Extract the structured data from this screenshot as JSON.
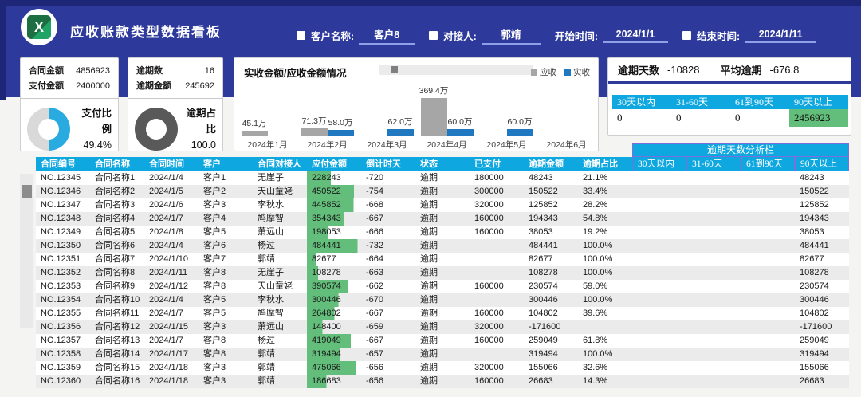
{
  "header": {
    "title": "应收账款类型数据看板",
    "filters": [
      {
        "label": "客户名称:",
        "value": "客户8"
      },
      {
        "label": "对接人:",
        "value": "郭靖"
      },
      {
        "label": "开始时间:",
        "value": "2024/1/1"
      },
      {
        "label": "结束时间:",
        "value": "2024/1/11"
      }
    ]
  },
  "cards": {
    "payment": {
      "label1": "合同金额",
      "value1": "4856923",
      "label2": "支付金额",
      "value2": "2400000",
      "donut_label": "支付比例",
      "donut_value": "49.4%",
      "percent": 49.4
    },
    "overdue": {
      "label1": "逾期数",
      "value1": "16",
      "label2": "逾期金额",
      "value2": "245692",
      "donut_label": "逾期占比",
      "donut_value": "100.0",
      "percent": 100
    }
  },
  "chart_data": {
    "type": "bar",
    "title": "实收金额/应收金额情况",
    "categories": [
      "2024年1月",
      "2024年2月",
      "2024年3月",
      "2024年4月",
      "2024年5月",
      "2024年6月"
    ],
    "series": [
      {
        "name": "应收",
        "color": "#a6a6a6",
        "values": [
          45.1,
          71.3,
          null,
          369.4,
          null,
          null
        ]
      },
      {
        "name": "实收",
        "color": "#1f78c0",
        "values": [
          null,
          58.0,
          62.0,
          60.0,
          60.0,
          null
        ]
      }
    ],
    "unit": "万",
    "ylim": [
      0,
      380
    ],
    "legend_position": "top-right",
    "grid": false
  },
  "overdue_panel": {
    "label1": "逾期天数",
    "value1": "-10828",
    "label2": "平均逾期",
    "value2": "-676.8",
    "bucket_headers": [
      "30天以内",
      "31-60天",
      "61到90天",
      "90天以上"
    ],
    "bucket_values": [
      "0",
      "0",
      "0",
      "2456923"
    ],
    "highlight_index": 3
  },
  "table": {
    "group_header": "逾期天数分析栏",
    "columns": [
      "合同编号",
      "合同名称",
      "合同时间",
      "客户",
      "合同对接人",
      "应付金额",
      "倒计时天",
      "状态",
      "已支付",
      "逾期金额",
      "逾期占比",
      "30天以内",
      "31-60天",
      "61到90天",
      "90天以上"
    ],
    "amount_bar_max": 520000,
    "rows": [
      [
        "NO.12345",
        "合同名称1",
        "2024/1/4",
        "客户1",
        "无崖子",
        "228243",
        "-720",
        "逾期",
        "180000",
        "48243",
        "21.1%",
        "",
        "",
        "",
        "48243"
      ],
      [
        "NO.12346",
        "合同名称2",
        "2024/1/5",
        "客户2",
        "天山童姥",
        "450522",
        "-754",
        "逾期",
        "300000",
        "150522",
        "33.4%",
        "",
        "",
        "",
        "150522"
      ],
      [
        "NO.12347",
        "合同名称3",
        "2024/1/6",
        "客户3",
        "李秋水",
        "445852",
        "-668",
        "逾期",
        "320000",
        "125852",
        "28.2%",
        "",
        "",
        "",
        "125852"
      ],
      [
        "NO.12348",
        "合同名称4",
        "2024/1/7",
        "客户4",
        "鸠摩智",
        "354343",
        "-667",
        "逾期",
        "160000",
        "194343",
        "54.8%",
        "",
        "",
        "",
        "194343"
      ],
      [
        "NO.12349",
        "合同名称5",
        "2024/1/8",
        "客户5",
        "萧远山",
        "198053",
        "-666",
        "逾期",
        "160000",
        "38053",
        "19.2%",
        "",
        "",
        "",
        "38053"
      ],
      [
        "NO.12350",
        "合同名称6",
        "2024/1/4",
        "客户6",
        "杨过",
        "484441",
        "-732",
        "逾期",
        "",
        "484441",
        "100.0%",
        "",
        "",
        "",
        "484441"
      ],
      [
        "NO.12351",
        "合同名称7",
        "2024/1/10",
        "客户7",
        "郭靖",
        "82677",
        "-664",
        "逾期",
        "",
        "82677",
        "100.0%",
        "",
        "",
        "",
        "82677"
      ],
      [
        "NO.12352",
        "合同名称8",
        "2024/1/11",
        "客户8",
        "无崖子",
        "108278",
        "-663",
        "逾期",
        "",
        "108278",
        "100.0%",
        "",
        "",
        "",
        "108278"
      ],
      [
        "NO.12353",
        "合同名称9",
        "2024/1/12",
        "客户8",
        "天山童姥",
        "390574",
        "-662",
        "逾期",
        "160000",
        "230574",
        "59.0%",
        "",
        "",
        "",
        "230574"
      ],
      [
        "NO.12354",
        "合同名称10",
        "2024/1/4",
        "客户5",
        "李秋水",
        "300446",
        "-670",
        "逾期",
        "",
        "300446",
        "100.0%",
        "",
        "",
        "",
        "300446"
      ],
      [
        "NO.12355",
        "合同名称11",
        "2024/1/7",
        "客户5",
        "鸠摩智",
        "264802",
        "-667",
        "逾期",
        "160000",
        "104802",
        "39.6%",
        "",
        "",
        "",
        "104802"
      ],
      [
        "NO.12356",
        "合同名称12",
        "2024/1/15",
        "客户3",
        "萧远山",
        "148400",
        "-659",
        "逾期",
        "320000",
        "-171600",
        "",
        "",
        "",
        "",
        "-171600"
      ],
      [
        "NO.12357",
        "合同名称13",
        "2024/1/7",
        "客户8",
        "杨过",
        "419049",
        "-667",
        "逾期",
        "160000",
        "259049",
        "61.8%",
        "",
        "",
        "",
        "259049"
      ],
      [
        "NO.12358",
        "合同名称14",
        "2024/1/17",
        "客户8",
        "郭靖",
        "319494",
        "-657",
        "逾期",
        "",
        "319494",
        "100.0%",
        "",
        "",
        "",
        "319494"
      ],
      [
        "NO.12359",
        "合同名称15",
        "2024/1/18",
        "客户3",
        "郭靖",
        "475066",
        "-656",
        "逾期",
        "320000",
        "155066",
        "32.6%",
        "",
        "",
        "",
        "155066"
      ],
      [
        "NO.12360",
        "合同名称16",
        "2024/1/18",
        "客户3",
        "郭靖",
        "186683",
        "-656",
        "逾期",
        "160000",
        "26683",
        "14.3%",
        "",
        "",
        "",
        "26683"
      ]
    ]
  },
  "colors": {
    "band_navy": "#2e3a9b",
    "strip_navy": "#1d2677",
    "cyan": "#0fa7e0",
    "green_bar": "#63be7b",
    "bar_gray": "#a6a6a6",
    "bar_blue": "#1f78c0",
    "donut_blue": "#29abe0",
    "donut_track": "#d9d9d9",
    "donut_gray": "#595959",
    "purple_border": "#7a70dd"
  }
}
